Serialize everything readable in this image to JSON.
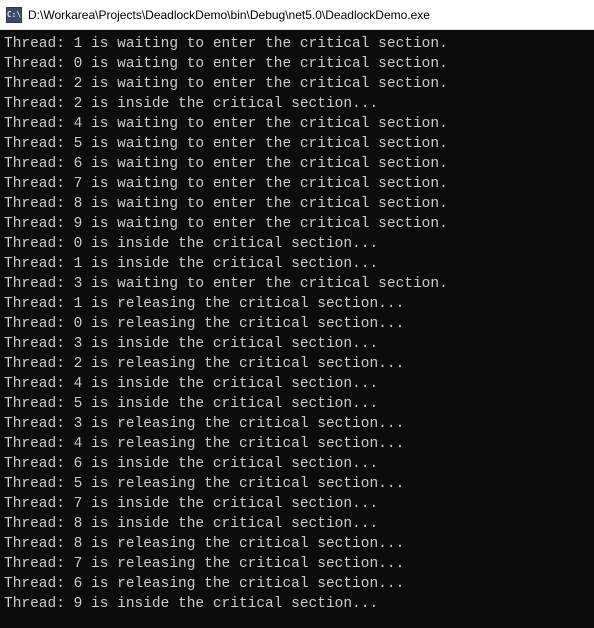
{
  "title_bar": {
    "icon_label": "C:\\",
    "path": "D:\\Workarea\\Projects\\DeadlockDemo\\bin\\Debug\\net5.0\\DeadlockDemo.exe"
  },
  "console": {
    "lines": [
      "Thread: 1 is waiting to enter the critical section.",
      "Thread: 0 is waiting to enter the critical section.",
      "Thread: 2 is waiting to enter the critical section.",
      "Thread: 2 is inside the critical section...",
      "Thread: 4 is waiting to enter the critical section.",
      "Thread: 5 is waiting to enter the critical section.",
      "Thread: 6 is waiting to enter the critical section.",
      "Thread: 7 is waiting to enter the critical section.",
      "Thread: 8 is waiting to enter the critical section.",
      "Thread: 9 is waiting to enter the critical section.",
      "Thread: 0 is inside the critical section...",
      "Thread: 1 is inside the critical section...",
      "Thread: 3 is waiting to enter the critical section.",
      "Thread: 1 is releasing the critical section...",
      "Thread: 0 is releasing the critical section...",
      "Thread: 3 is inside the critical section...",
      "Thread: 2 is releasing the critical section...",
      "Thread: 4 is inside the critical section...",
      "Thread: 5 is inside the critical section...",
      "Thread: 3 is releasing the critical section...",
      "Thread: 4 is releasing the critical section...",
      "Thread: 6 is inside the critical section...",
      "Thread: 5 is releasing the critical section...",
      "Thread: 7 is inside the critical section...",
      "Thread: 8 is inside the critical section...",
      "Thread: 8 is releasing the critical section...",
      "Thread: 7 is releasing the critical section...",
      "Thread: 6 is releasing the critical section...",
      "Thread: 9 is inside the critical section..."
    ]
  }
}
